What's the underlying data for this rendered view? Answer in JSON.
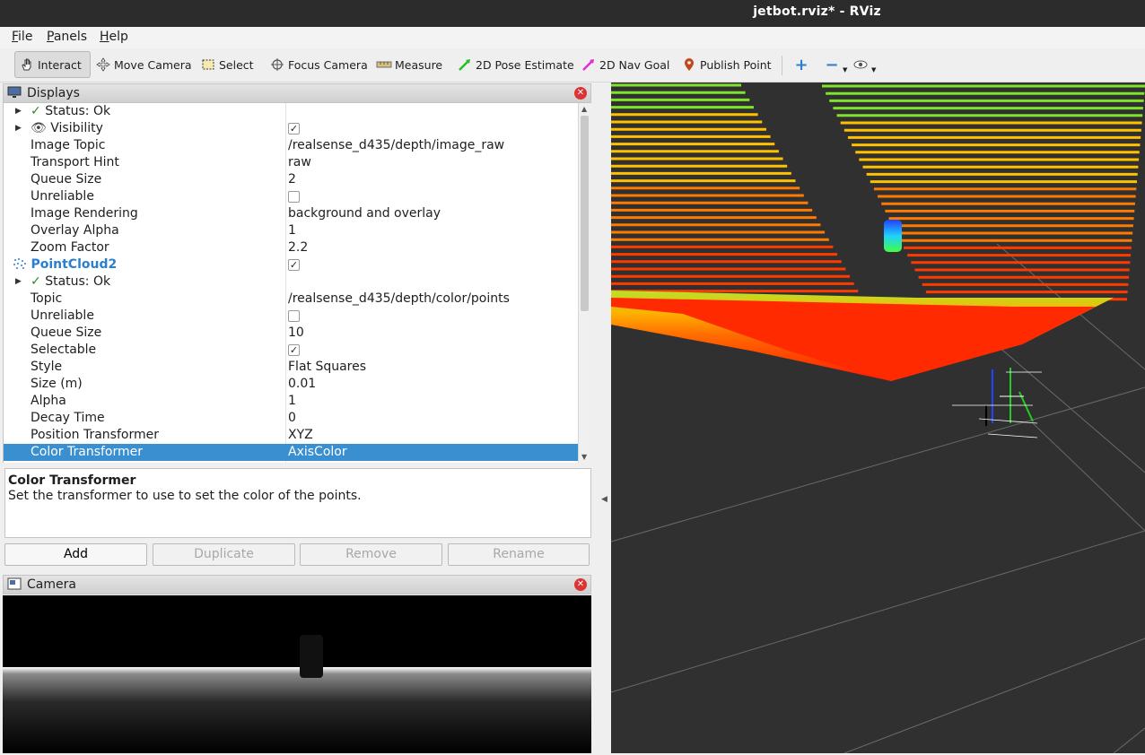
{
  "window": {
    "title": "jetbot.rviz* - RViz"
  },
  "menu": [
    {
      "label": "File",
      "key": "F",
      "rest": "ile"
    },
    {
      "label": "Panels",
      "key": "P",
      "rest": "anels"
    },
    {
      "label": "Help",
      "key": "H",
      "rest": "elp"
    }
  ],
  "toolbar": {
    "interact": "Interact",
    "move_camera": "Move Camera",
    "select": "Select",
    "focus_camera": "Focus Camera",
    "measure": "Measure",
    "pose_estimate": "2D Pose Estimate",
    "nav_goal": "2D Nav Goal",
    "publish_point": "Publish Point"
  },
  "displays": {
    "title": "Displays",
    "rows": [
      {
        "label": "Status: Ok",
        "value": "",
        "kind": "status"
      },
      {
        "label": "Visibility",
        "value": "✓",
        "kind": "visibility"
      },
      {
        "label": "Image Topic",
        "value": "/realsense_d435/depth/image_raw"
      },
      {
        "label": "Transport Hint",
        "value": "raw"
      },
      {
        "label": "Queue Size",
        "value": "2"
      },
      {
        "label": "Unreliable",
        "value": "",
        "kind": "checkbox"
      },
      {
        "label": "Image Rendering",
        "value": "background and overlay"
      },
      {
        "label": "Overlay Alpha",
        "value": "1"
      },
      {
        "label": "Zoom Factor",
        "value": "2.2"
      },
      {
        "label": "PointCloud2",
        "value": "✓",
        "kind": "display"
      },
      {
        "label": "Status: Ok",
        "value": "",
        "kind": "status"
      },
      {
        "label": "Topic",
        "value": "/realsense_d435/depth/color/points"
      },
      {
        "label": "Unreliable",
        "value": "",
        "kind": "checkbox"
      },
      {
        "label": "Queue Size",
        "value": "10"
      },
      {
        "label": "Selectable",
        "value": "✓",
        "kind": "checkbox"
      },
      {
        "label": "Style",
        "value": "Flat Squares"
      },
      {
        "label": "Size (m)",
        "value": "0.01"
      },
      {
        "label": "Alpha",
        "value": "1"
      },
      {
        "label": "Decay Time",
        "value": "0"
      },
      {
        "label": "Position Transformer",
        "value": "XYZ"
      },
      {
        "label": "Color Transformer",
        "value": "AxisColor",
        "kind": "selected"
      }
    ]
  },
  "description": {
    "title": "Color Transformer",
    "text": "Set the transformer to use to set the color of the points."
  },
  "buttons": {
    "add": "Add",
    "duplicate": "Duplicate",
    "remove": "Remove",
    "rename": "Rename"
  },
  "camera_panel": {
    "title": "Camera"
  },
  "colors": {
    "selection": "#3a8fd1",
    "viewport_bg": "#303030",
    "status_ok": "#2a8a2a"
  }
}
